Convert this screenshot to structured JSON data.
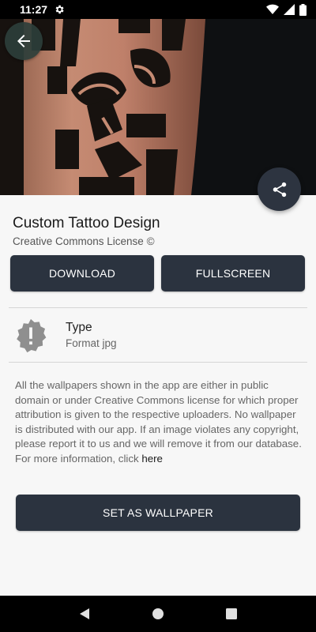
{
  "status_bar": {
    "time": "11:27",
    "icons": [
      "settings-gear-icon",
      "wifi-icon",
      "signal-icon",
      "battery-icon"
    ]
  },
  "header": {
    "back_icon": "arrow-left-icon",
    "share_icon": "share-icon"
  },
  "wallpaper": {
    "title": "Custom Tattoo Design",
    "license": "Creative Commons License ©"
  },
  "actions": {
    "download_label": "DOWNLOAD",
    "fullscreen_label": "FULLSCREEN",
    "set_wallpaper_label": "SET AS WALLPAPER"
  },
  "info": {
    "type_label": "Type",
    "type_value": "Format jpg",
    "type_icon": "alert-badge-icon"
  },
  "disclaimer": {
    "text": "All the wallpapers shown in the app are either in public domain or under Creative Commons license for which proper attribution is given to the respective uploaders. No wallpaper is distributed with our app. If an image violates any copyright, please report it to us and we will remove it from our database. For more information, click ",
    "link": "here"
  },
  "nav_bar": {
    "icons": [
      "nav-back-icon",
      "nav-home-icon",
      "nav-recents-icon"
    ]
  },
  "colors": {
    "button_bg": "#2b333f",
    "page_bg": "#f7f7f7",
    "back_button_bg": "#2c3e3a"
  }
}
